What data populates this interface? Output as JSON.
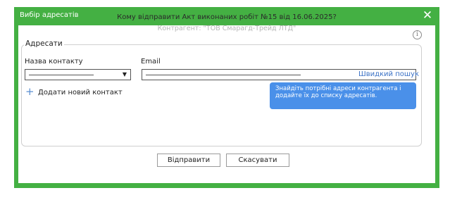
{
  "dialog": {
    "title": "Вибір адресатів",
    "close_symbol": "✕"
  },
  "prompt": {
    "question": "Кому відправити Акт виконаних робіт №15 від 16.06.2025?",
    "contractor": "Контрагент: \"ТОВ Смарагд-Трейд ЛТД\"",
    "info_icon": "i"
  },
  "recipients": {
    "legend": "Адресати",
    "name_column_label": "Назва контакту",
    "email_column_label": "Email",
    "contact_select_value": "",
    "dropdown_arrow": "▼",
    "email_value": "",
    "quick_search_label": "Швидкий пошук",
    "add_contact_icon": "+",
    "add_contact_label": "Додати новий контакт",
    "hint": "Знайдіть потрібні адреси контрагента і додайте їх до списку адресатів."
  },
  "buttons": {
    "send_label": "Відправити",
    "cancel_label": "Скасувати"
  },
  "colors": {
    "frame": "#44b043",
    "hint_bg": "#4a90e9",
    "link": "#3b72c6"
  }
}
